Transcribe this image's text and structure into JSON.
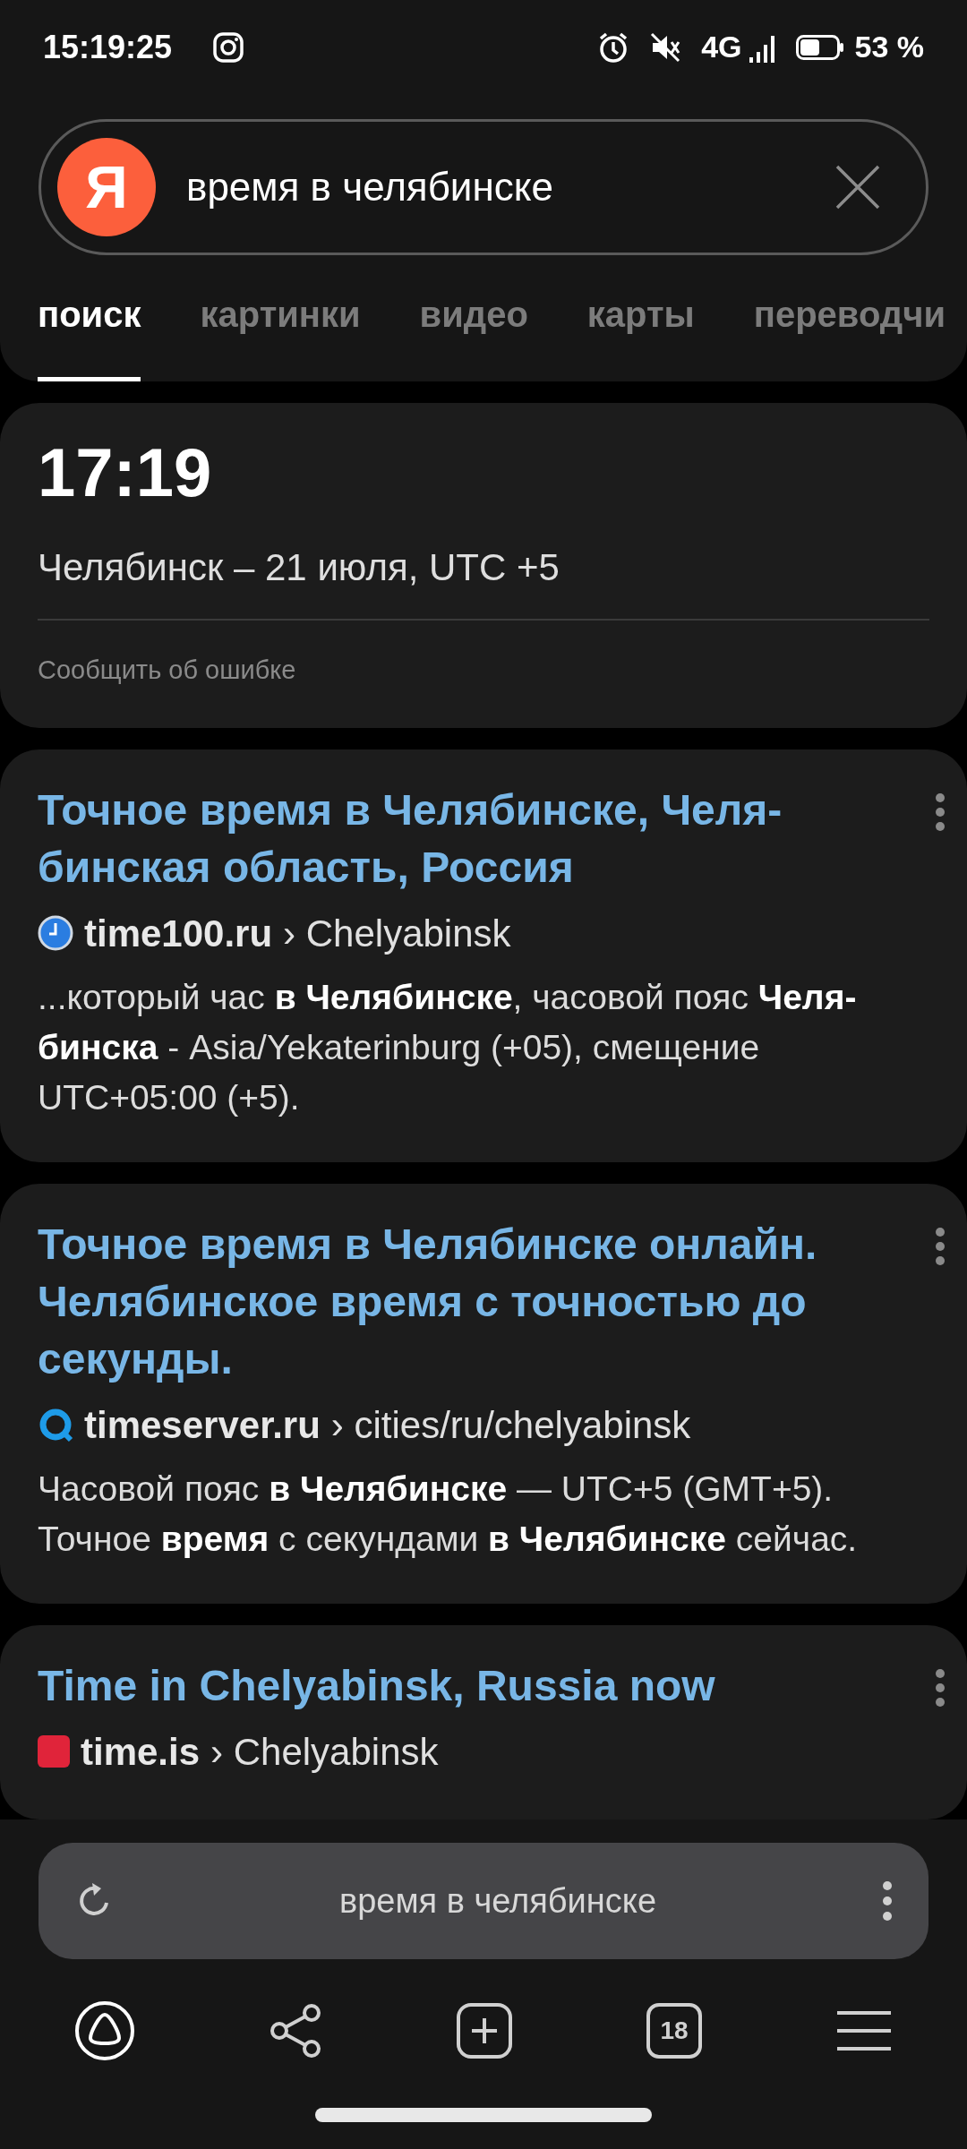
{
  "status_bar": {
    "time": "15:19:25",
    "network": "4G",
    "battery": "53 %"
  },
  "search": {
    "logo": "Я",
    "value": "время в челябинске"
  },
  "tabs": [
    {
      "label": "поиск",
      "selected": true
    },
    {
      "label": "картинки",
      "selected": false
    },
    {
      "label": "видео",
      "selected": false
    },
    {
      "label": "карты",
      "selected": false
    },
    {
      "label": "переводчи",
      "selected": false
    }
  ],
  "time_card": {
    "time": "17:19",
    "subtitle": "Челябинск – 21 июля, UTC +5",
    "report_link": "Сообщить об ошибке"
  },
  "results": [
    {
      "title": "Точное время в Челябинске, Челя-бинская область, Россия",
      "domain": "time100.ru",
      "path": "› Chelyabinsk",
      "snippet": "...который час **в Челябинске**, часовой пояс **Челя-бинска** - Asia/Yekaterinburg (+05), смещение UTC+05:00 (+5)."
    },
    {
      "title": "Точное время в Челябинске онлайн. Челябинское время с точностью до секунды.",
      "domain": "timeserver.ru",
      "path": "› cities/ru/chelyabinsk",
      "snippet": "Часовой пояс **в Челябинске** — UTC+5 (GMT+5). Точное **время** с секундами **в Челябинске** сейчас."
    },
    {
      "title": "Time in Chelyabinsk, Russia now",
      "domain": "time.is",
      "path": "› Chelyabinsk"
    }
  ],
  "address_bar": {
    "text": "время в челябинске"
  },
  "nav": {
    "tabs_count": "18"
  }
}
